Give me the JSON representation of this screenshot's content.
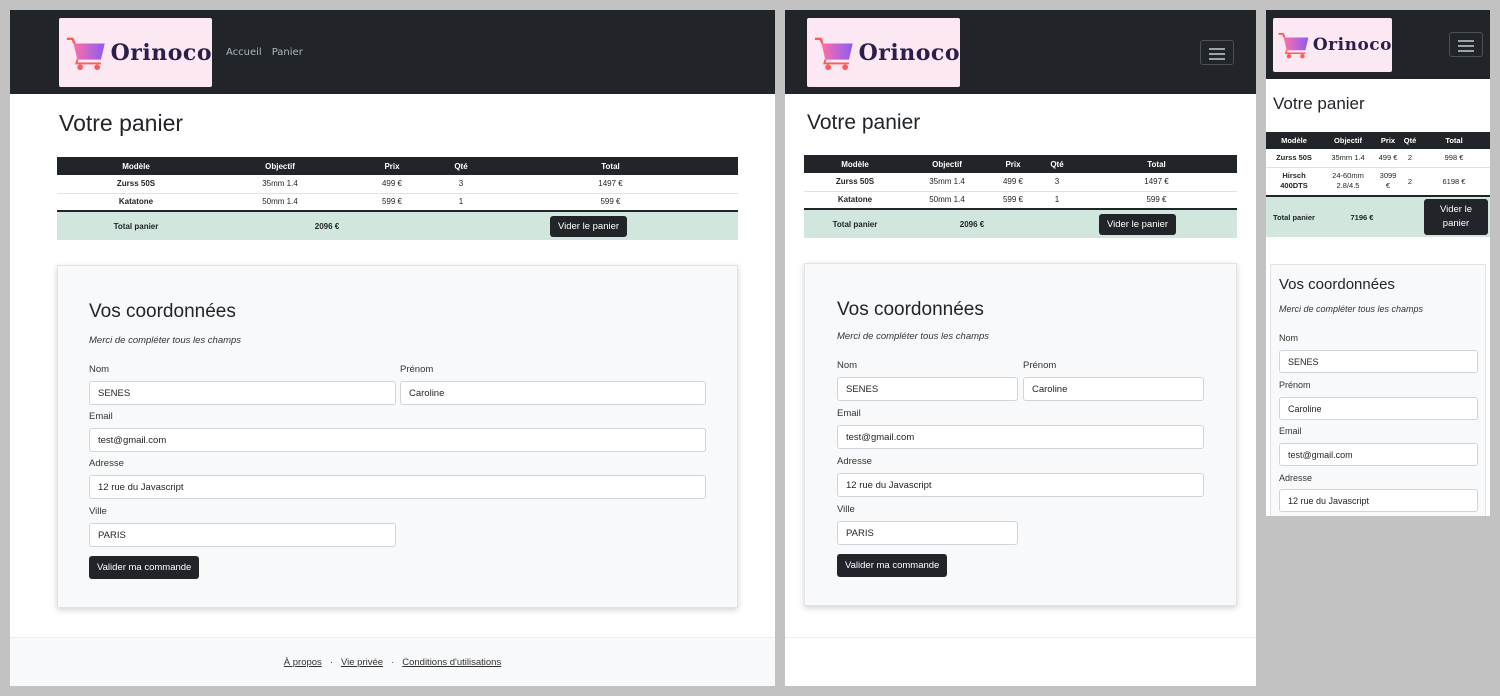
{
  "brand": {
    "name": "Orinoco"
  },
  "nav": {
    "home": "Accueil",
    "cart": "Panier"
  },
  "page_title": "Votre panier",
  "cart": {
    "headers": {
      "model": "Modèle",
      "lens": "Objectif",
      "price": "Prix",
      "qty": "Qté",
      "total": "Total"
    },
    "rows_a": [
      {
        "model": "Zurss 50S",
        "lens": "35mm 1.4",
        "price": "499 €",
        "qty": "3",
        "total": "1497 €"
      },
      {
        "model": "Katatone",
        "lens": "50mm 1.4",
        "price": "599 €",
        "qty": "1",
        "total": "599 €"
      }
    ],
    "total_label": "Total panier",
    "total_a": "2096 €",
    "empty_button": "Vider le panier"
  },
  "cart_mobile": {
    "rows": [
      {
        "model": "Zurss 50S",
        "lens": "35mm 1.4",
        "price": "499 €",
        "qty": "2",
        "total": "998 €"
      },
      {
        "model_line1": "Hirsch",
        "model_line2": "400DTS",
        "lens_line1": "24-60mm",
        "lens_line2": "2.8/4.5",
        "price_line1": "3099",
        "price_line2": "€",
        "qty": "2",
        "total": "6198 €"
      }
    ],
    "total": "7196 €",
    "empty_line1": "Vider le",
    "empty_line2": "panier"
  },
  "form": {
    "title": "Vos coordonnées",
    "subtitle": "Merci de compléter tous les champs",
    "labels": {
      "lastname": "Nom",
      "firstname": "Prénom",
      "email": "Email",
      "address": "Adresse",
      "city": "Ville"
    },
    "values": {
      "lastname": "SENES",
      "firstname": "Caroline",
      "email": "test@gmail.com",
      "address": "12 rue du Javascript",
      "city": "PARIS"
    },
    "submit": "Valider ma commande"
  },
  "footer": {
    "about": "À propos",
    "privacy": "Vie privée",
    "terms": "Conditions d'utilisations",
    "sep": "·"
  },
  "colors": {
    "navbar": "#212529",
    "total_row": "#d1e7dd",
    "logo_bg": "#fce8f2",
    "cart_gradient_from": "#ff6fa8",
    "cart_gradient_to": "#8a5cf6"
  }
}
